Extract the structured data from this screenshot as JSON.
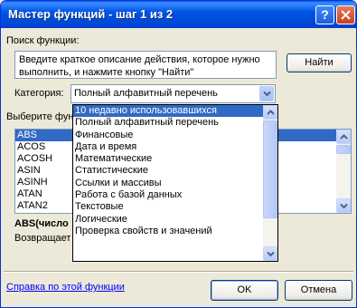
{
  "window": {
    "title": "Мастер функций - шаг 1 из 2",
    "help_glyph": "?"
  },
  "search": {
    "label": "Поиск функции:",
    "value": "Введите краткое описание действия, которое нужно выполнить, и нажмите кнопку \"Найти\"",
    "find_button": "Найти"
  },
  "category": {
    "label": "Категория:",
    "selected": "Полный алфавитный перечень",
    "options": [
      "10 недавно использовавшихся",
      "Полный алфавитный перечень",
      "Финансовые",
      "Дата и время",
      "Математические",
      "Статистические",
      "Ссылки и массивы",
      "Работа с базой данных",
      "Текстовые",
      "Логические",
      "Проверка свойств и значений"
    ]
  },
  "functions": {
    "label": "Выберите фун",
    "items": [
      "ABS",
      "ACOS",
      "ACOSH",
      "ASIN",
      "ASINH",
      "ATAN",
      "ATAN2"
    ]
  },
  "syntax": {
    "signature": "ABS(число",
    "description": "Возвращает модуль (абсолютную величину) числа."
  },
  "footer": {
    "help_link": "Справка по этой функции",
    "ok_button": "OK",
    "cancel_button": "Отмена"
  },
  "colors": {
    "title_bar": "#0054E3",
    "selection": "#316AC5",
    "dialog_bg": "#ECE9D8",
    "close_button": "#D8502E",
    "link": "#0000FF"
  }
}
